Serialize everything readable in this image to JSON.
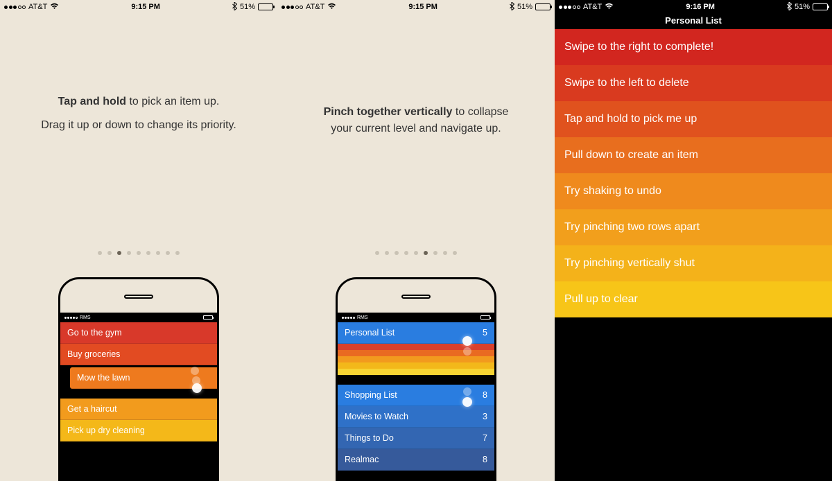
{
  "status": {
    "carrier": "AT&T",
    "time_915": "9:15 PM",
    "time_916": "9:16 PM",
    "battery_pct": "51%",
    "mini_carrier": "RMS"
  },
  "panel1": {
    "bold": "Tap and hold",
    "rest1": " to pick an item up.",
    "line2": "Drag it up or down to change its priority.",
    "page_active_index": 2,
    "page_count": 9,
    "phone_rows": [
      {
        "label": "Go to the gym",
        "color": "#d8392a"
      },
      {
        "label": "Buy groceries",
        "color": "#e24b22"
      },
      {
        "label": "Mow the lawn",
        "color": "#ee7a1e",
        "indent": true
      },
      {
        "label": "Get a haircut",
        "color": "#f29b1d"
      },
      {
        "label": "Pick up dry cleaning",
        "color": "#f4b819"
      }
    ]
  },
  "panel2": {
    "bold": "Pinch together vertically",
    "rest1": " to collapse your current level and navigate up.",
    "page_active_index": 5,
    "page_count": 9,
    "phone_rows": [
      {
        "label": "Personal List",
        "count": "5",
        "color": "#2a7de0"
      },
      {
        "stripes": [
          "#d9402d",
          "#e96a21",
          "#f29a1e",
          "#f3b81a",
          "#f7d433"
        ]
      },
      {
        "label": "Shopping List",
        "count": "8",
        "color": "#2a7de0"
      },
      {
        "label": "Movies to Watch",
        "count": "3",
        "color": "#2f71c8"
      },
      {
        "label": "Things to Do",
        "count": "7",
        "color": "#3366b2"
      },
      {
        "label": "Realmac",
        "count": "8",
        "color": "#365a9b"
      }
    ]
  },
  "panel3": {
    "title": "Personal List",
    "rows": [
      {
        "label": "Swipe to the right to complete!",
        "color": "#d2261f"
      },
      {
        "label": "Swipe to the left to delete",
        "color": "#d93a1f"
      },
      {
        "label": "Tap and hold to pick me up",
        "color": "#e0521e"
      },
      {
        "label": "Pull down to create an item",
        "color": "#e86e1e"
      },
      {
        "label": "Try shaking to undo",
        "color": "#ef8a1d"
      },
      {
        "label": "Try pinching two rows apart",
        "color": "#f29f1c"
      },
      {
        "label": "Try pinching vertically shut",
        "color": "#f4b21a"
      },
      {
        "label": "Pull up to clear",
        "color": "#f7c518"
      }
    ]
  }
}
